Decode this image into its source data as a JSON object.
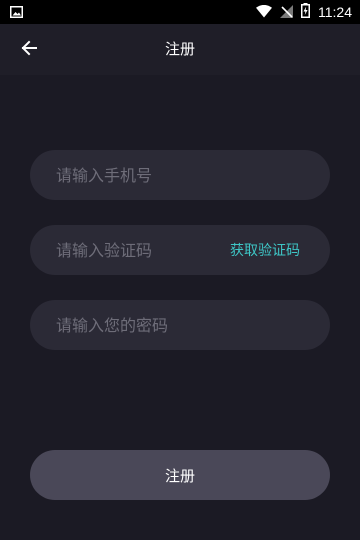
{
  "status_bar": {
    "time": "11:24",
    "icons": [
      "image-notification-icon",
      "wifi-icon",
      "no-signal-icon",
      "battery-charging-icon"
    ]
  },
  "app_bar": {
    "title": "注册",
    "back_icon": "arrow-left-icon"
  },
  "form": {
    "phone_placeholder": "请输入手机号",
    "code_placeholder": "请输入验证码",
    "get_code_label": "获取验证码",
    "password_placeholder": "请输入您的密码"
  },
  "register_button": "注册",
  "colors": {
    "background": "#1b1a24",
    "app_bar": "#1f1e28",
    "field": "#2b2a36",
    "button": "#4a4858",
    "accent": "#3ec6c6",
    "placeholder": "#6e6d79"
  }
}
